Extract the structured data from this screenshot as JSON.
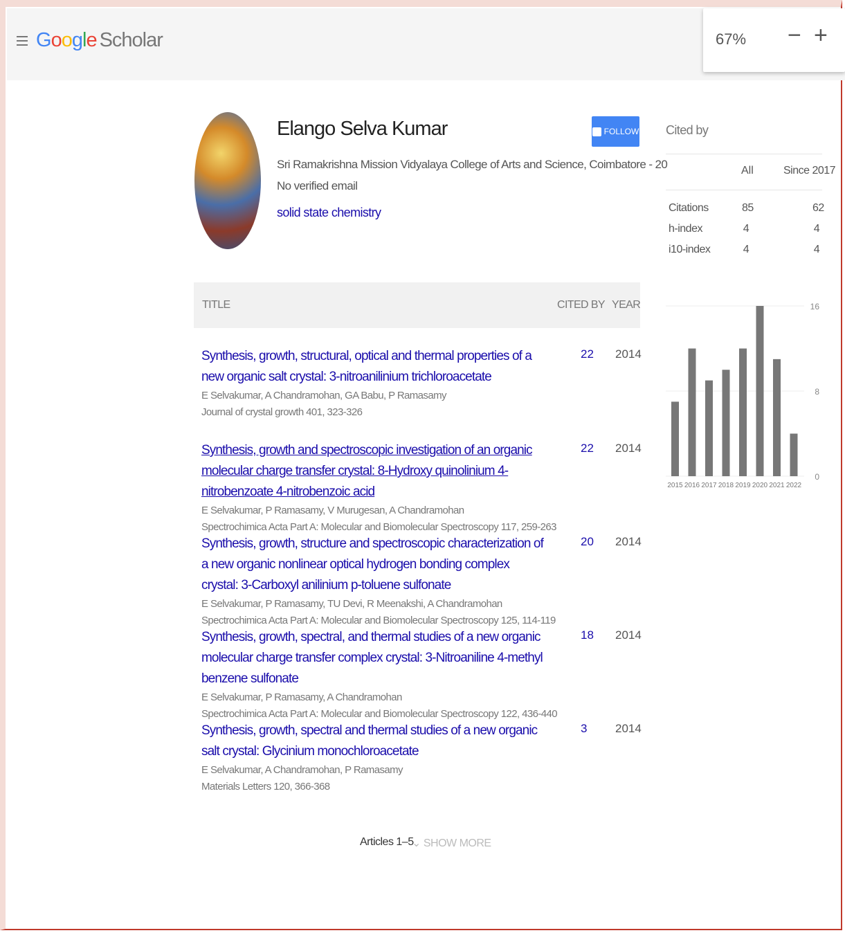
{
  "app": {
    "logo_letters": [
      "G",
      "o",
      "o",
      "g",
      "l",
      "e"
    ],
    "logo_suffix": "Scholar",
    "zoom_level": "67%",
    "zoom_out": "−",
    "zoom_in": "+"
  },
  "profile": {
    "name": "Elango Selva Kumar",
    "affiliation": "Sri Ramakrishna Mission Vidyalaya College of Arts and Science, Coimbatore - 20",
    "email": "No verified email",
    "interest": "solid state chemistry",
    "follow_label": "FOLLOW"
  },
  "table": {
    "col_title": "TITLE",
    "col_cited": "CITED BY",
    "col_year": "YEAR",
    "articles": [
      {
        "title": "Synthesis, growth, structural, optical and thermal properties of a new organic salt crystal: 3-nitroanilinium trichloroacetate",
        "authors": "E Selvakumar, A Chandramohan, GA Babu, P Ramasamy",
        "venue": "Journal of crystal growth 401, 323-326",
        "cited": "22",
        "year": "2014",
        "visited": false
      },
      {
        "title": "Synthesis, growth and spectroscopic investigation of an organic molecular charge transfer crystal: 8-Hydroxy quinolinium 4-nitrobenzoate 4-nitrobenzoic acid",
        "authors": "E Selvakumar, P Ramasamy, V Murugesan, A Chandramohan",
        "venue": "Spectrochimica Acta Part A: Molecular and Biomolecular Spectroscopy 117, 259-263",
        "cited": "22",
        "year": "2014",
        "visited": true
      },
      {
        "title": "Synthesis, growth, structure and spectroscopic characterization of a new organic nonlinear optical hydrogen bonding complex crystal: 3-Carboxyl anilinium p-toluene sulfonate",
        "authors": "E Selvakumar, P Ramasamy, TU Devi, R Meenakshi, A Chandramohan",
        "venue": "Spectrochimica Acta Part A: Molecular and Biomolecular Spectroscopy 125, 114-119",
        "cited": "20",
        "year": "2014",
        "visited": false
      },
      {
        "title": "Synthesis, growth, spectral, and thermal studies of a new organic molecular charge transfer complex crystal: 3-Nitroaniline 4-methyl benzene sulfonate",
        "authors": "E Selvakumar, P Ramasamy, A Chandramohan",
        "venue": "Spectrochimica Acta Part A: Molecular and Biomolecular Spectroscopy 122, 436-440",
        "cited": "18",
        "year": "2014",
        "visited": false
      },
      {
        "title": "Synthesis, growth, spectral and thermal studies of a new organic salt crystal: Glycinium monochloroacetate",
        "authors": "E Selvakumar, A Chandramohan, P Ramasamy",
        "venue": "Materials Letters 120, 366-368",
        "cited": "3",
        "year": "2014",
        "visited": false
      }
    ],
    "footer_count": "Articles 1–5",
    "show_more": "SHOW MORE"
  },
  "sidebar": {
    "title": "Cited by",
    "col_all": "All",
    "col_since": "Since 2017",
    "stats": [
      {
        "label": "Citations",
        "all": "85",
        "since": "62"
      },
      {
        "label": "h-index",
        "all": "4",
        "since": "4"
      },
      {
        "label": "i10-index",
        "all": "4",
        "since": "4"
      }
    ]
  },
  "chart_data": {
    "type": "bar",
    "categories": [
      "2015",
      "2016",
      "2017",
      "2018",
      "2019",
      "2020",
      "2021",
      "2022"
    ],
    "values": [
      7,
      12,
      9,
      10,
      12,
      16,
      11,
      4
    ],
    "ylim": [
      0,
      16
    ],
    "yticks": [
      "16",
      "8",
      "0"
    ],
    "bar_color": "#777777"
  }
}
